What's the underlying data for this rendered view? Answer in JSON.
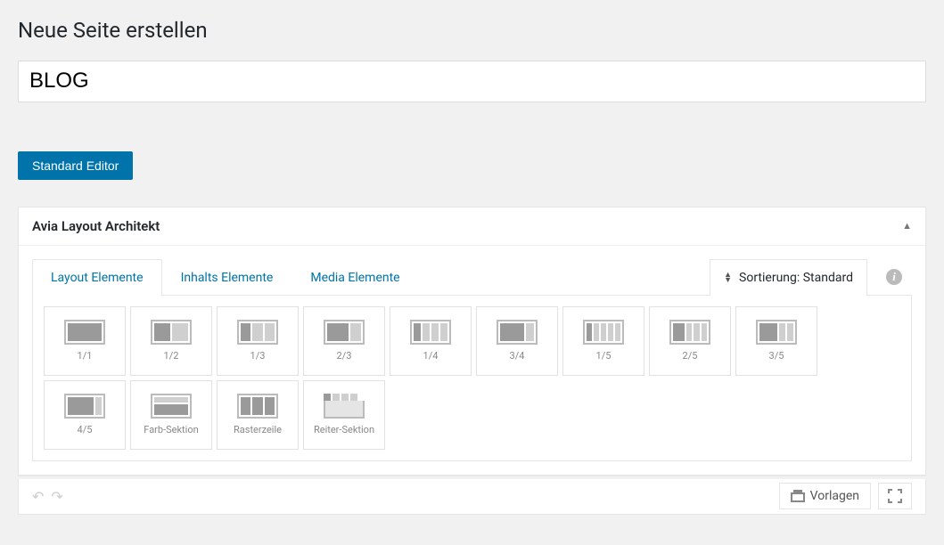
{
  "page": {
    "heading": "Neue Seite erstellen",
    "title_value": "BLOG",
    "editor_toggle_label": "Standard Editor"
  },
  "panel": {
    "title": "Avia Layout Architekt"
  },
  "tabs": {
    "layout": "Layout Elemente",
    "content": "Inhalts Elemente",
    "media": "Media Elemente"
  },
  "sort": {
    "label": "Sortierung: Standard"
  },
  "elements": [
    {
      "label": "1/1"
    },
    {
      "label": "1/2"
    },
    {
      "label": "1/3"
    },
    {
      "label": "2/3"
    },
    {
      "label": "1/4"
    },
    {
      "label": "3/4"
    },
    {
      "label": "1/5"
    },
    {
      "label": "2/5"
    },
    {
      "label": "3/5"
    },
    {
      "label": "4/5"
    },
    {
      "label": "Farb-Sektion"
    },
    {
      "label": "Rasterzeile"
    },
    {
      "label": "Reiter-Sektion"
    }
  ],
  "footer": {
    "templates_label": "Vorlagen"
  }
}
